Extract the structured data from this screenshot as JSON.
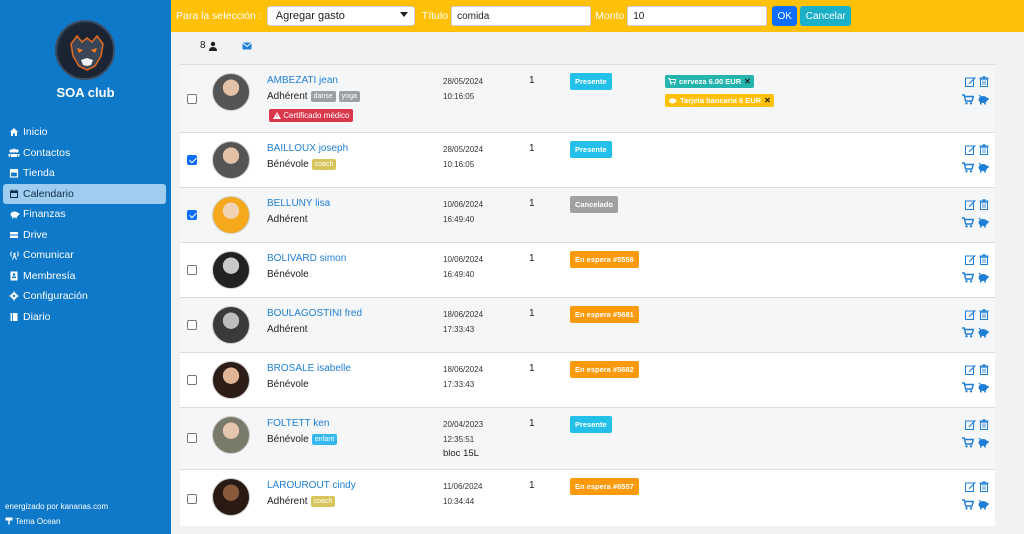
{
  "sidebar": {
    "club_name": "SOA club",
    "nav": [
      {
        "label": "Inicio",
        "icon": "home-icon"
      },
      {
        "label": "Contactos",
        "icon": "users-icon"
      },
      {
        "label": "Tienda",
        "icon": "store-icon"
      },
      {
        "label": "Calendario",
        "icon": "calendar-icon",
        "active": true
      },
      {
        "label": "Finanzas",
        "icon": "piggy-bank-icon"
      },
      {
        "label": "Drive",
        "icon": "drive-icon"
      },
      {
        "label": "Comunicar",
        "icon": "broadcast-icon"
      },
      {
        "label": "Membresía",
        "icon": "id-card-icon"
      },
      {
        "label": "Configuración",
        "icon": "gear-icon"
      },
      {
        "label": "Diario",
        "icon": "diary-icon"
      }
    ],
    "powered_by": "energizado por kananas.com",
    "theme": "Tema Ocean"
  },
  "toolbar": {
    "selection_label": "Para la selección :",
    "action_value": "Agregar gasto",
    "title_label": "Título",
    "title_value": "comida",
    "amount_label": "Monto",
    "amount_value": "10",
    "ok_label": "OK",
    "cancel_label": "Cancelar"
  },
  "header": {
    "participant_count": "8"
  },
  "colors": {
    "sidebar": "#0e78c9",
    "topbar": "#ffc107",
    "presente": "#23c1ea",
    "cancelado": "#a1a1a1",
    "en_espera": "#fb9a0c",
    "certificado": "#d9384c",
    "link": "#1f7fd6"
  },
  "participants": [
    {
      "name": "AMBEZATI jean",
      "role": "Adhérent",
      "tags": [
        "danse",
        "yoga"
      ],
      "date": "28/05/2024",
      "time": "10:16:05",
      "qty": "1",
      "status": "Presente",
      "checked": false,
      "certificate": "Certificado médico",
      "chips": [
        "cerveza 6.00 EUR",
        "Tarjeta bancaria 6 EUR"
      ]
    },
    {
      "name": "BAILLOUX joseph",
      "role": "Bénévole",
      "tags": [
        "coach"
      ],
      "date": "28/05/2024",
      "time": "10:16:05",
      "qty": "1",
      "status": "Presente",
      "checked": true
    },
    {
      "name": "BELLUNY lisa",
      "role": "Adhérent",
      "tags": [],
      "date": "10/06/2024",
      "time": "16:49:40",
      "qty": "1",
      "status": "Cancelado",
      "checked": true
    },
    {
      "name": "BOLIVARD simon",
      "role": "Bénévole",
      "tags": [],
      "date": "10/06/2024",
      "time": "16:49:40",
      "qty": "1",
      "status": "En espera #5556",
      "checked": false
    },
    {
      "name": "BOULAGOSTINI fred",
      "role": "Adhérent",
      "tags": [],
      "date": "18/06/2024",
      "time": "17:33:43",
      "qty": "1",
      "status": "En espera #5681",
      "checked": false
    },
    {
      "name": "BROSALE isabelle",
      "role": "Bénévole",
      "tags": [],
      "date": "18/06/2024",
      "time": "17:33:43",
      "qty": "1",
      "status": "En espera #5682",
      "checked": false
    },
    {
      "name": "FOLTETT ken",
      "role": "Bénévole",
      "tags": [
        "enfant"
      ],
      "date": "20/04/2023",
      "time": "12:35:51",
      "qty": "1",
      "status": "Presente",
      "checked": false,
      "note": "bloc 15L"
    },
    {
      "name": "LAROUROUT cindy",
      "role": "Adhérent",
      "tags": [
        "coach"
      ],
      "date": "11/06/2024",
      "time": "10:34:44",
      "qty": "1",
      "status": "En espera #6557",
      "checked": false
    }
  ]
}
